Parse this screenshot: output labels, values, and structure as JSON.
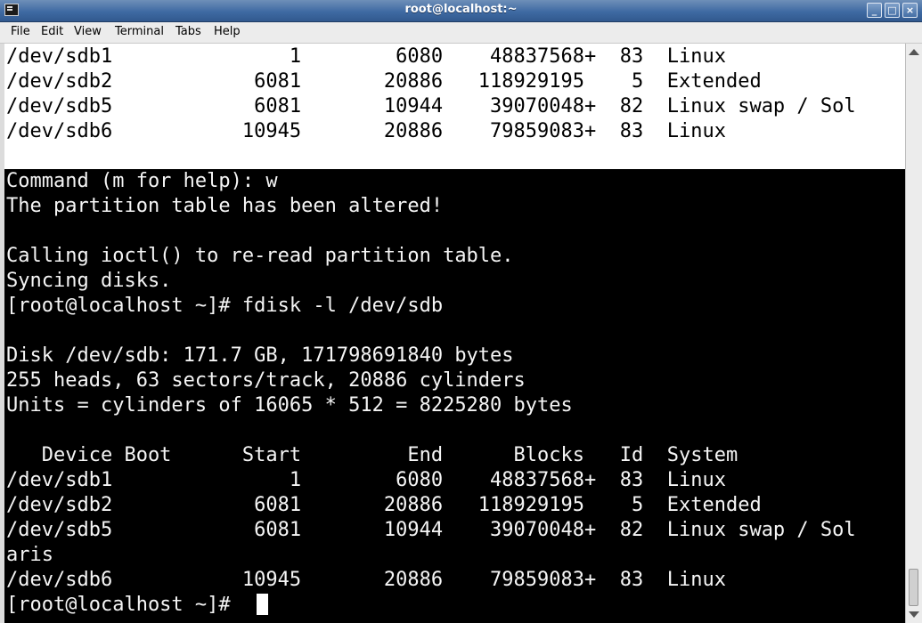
{
  "window": {
    "title": "root@localhost:~",
    "controls": {
      "minimize": "_",
      "maximize": "□",
      "close": "×"
    }
  },
  "menu": {
    "items": [
      "File",
      "Edit",
      "View",
      "Terminal",
      "Tabs",
      "Help"
    ]
  },
  "terminal": {
    "top_lines": [
      "/dev/sdb1               1        6080    48837568+  83  Linux",
      "/dev/sdb2            6081       20886   118929195    5  Extended",
      "/dev/sdb5            6081       10944    39070048+  82  Linux swap / Sol",
      "/dev/sdb6           10945       20886    79859083+  83  Linux"
    ],
    "lines": [
      "Command (m for help): w",
      "The partition table has been altered!",
      "",
      "Calling ioctl() to re-read partition table.",
      "Syncing disks.",
      "[root@localhost ~]# fdisk -l /dev/sdb",
      "",
      "Disk /dev/sdb: 171.7 GB, 171798691840 bytes",
      "255 heads, 63 sectors/track, 20886 cylinders",
      "Units = cylinders of 16065 * 512 = 8225280 bytes",
      "",
      "   Device Boot      Start         End      Blocks   Id  System",
      "/dev/sdb1               1        6080    48837568+  83  Linux",
      "/dev/sdb2            6081       20886   118929195    5  Extended",
      "/dev/sdb5            6081       10944    39070048+  82  Linux swap / Sol",
      "aris",
      "/dev/sdb6           10945       20886    79859083+  83  Linux",
      "[root@localhost ~]# "
    ]
  },
  "colors": {
    "terminal_bg": "#000000",
    "terminal_text": "#f5f5f5",
    "highlight_bg": "#ffffff",
    "titlebar": "#3f6aa3"
  }
}
